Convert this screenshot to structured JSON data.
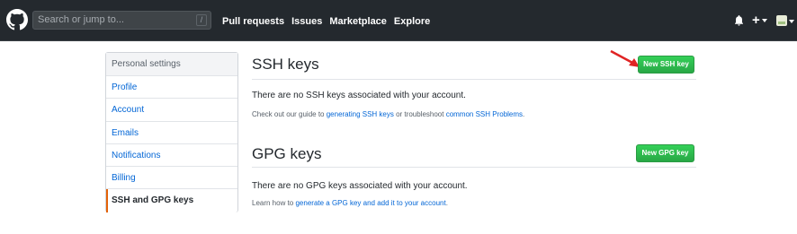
{
  "header": {
    "search_placeholder": "Search or jump to...",
    "search_shortcut": "/",
    "nav": [
      "Pull requests",
      "Issues",
      "Marketplace",
      "Explore"
    ],
    "plus_label": "+"
  },
  "sidebar": {
    "heading": "Personal settings",
    "items": [
      {
        "label": "Profile"
      },
      {
        "label": "Account"
      },
      {
        "label": "Emails"
      },
      {
        "label": "Notifications"
      },
      {
        "label": "Billing"
      },
      {
        "label": "SSH and GPG keys"
      }
    ]
  },
  "ssh": {
    "title": "SSH keys",
    "button": "New SSH key",
    "empty": "There are no SSH keys associated with your account.",
    "help_prefix": "Check out our guide to ",
    "help_link1": "generating SSH keys",
    "help_middle": " or troubleshoot ",
    "help_link2": "common SSH Problems",
    "help_suffix": "."
  },
  "gpg": {
    "title": "GPG keys",
    "button": "New GPG key",
    "empty": "There are no GPG keys associated with your account.",
    "help_prefix": "Learn how to ",
    "help_link": "generate a GPG key and add it to your account",
    "help_suffix": "."
  },
  "colors": {
    "header_bg": "#24292e",
    "link": "#0366d6",
    "button_green": "#28a745",
    "selected_accent": "#e36209",
    "annotation_arrow": "#e02424"
  }
}
